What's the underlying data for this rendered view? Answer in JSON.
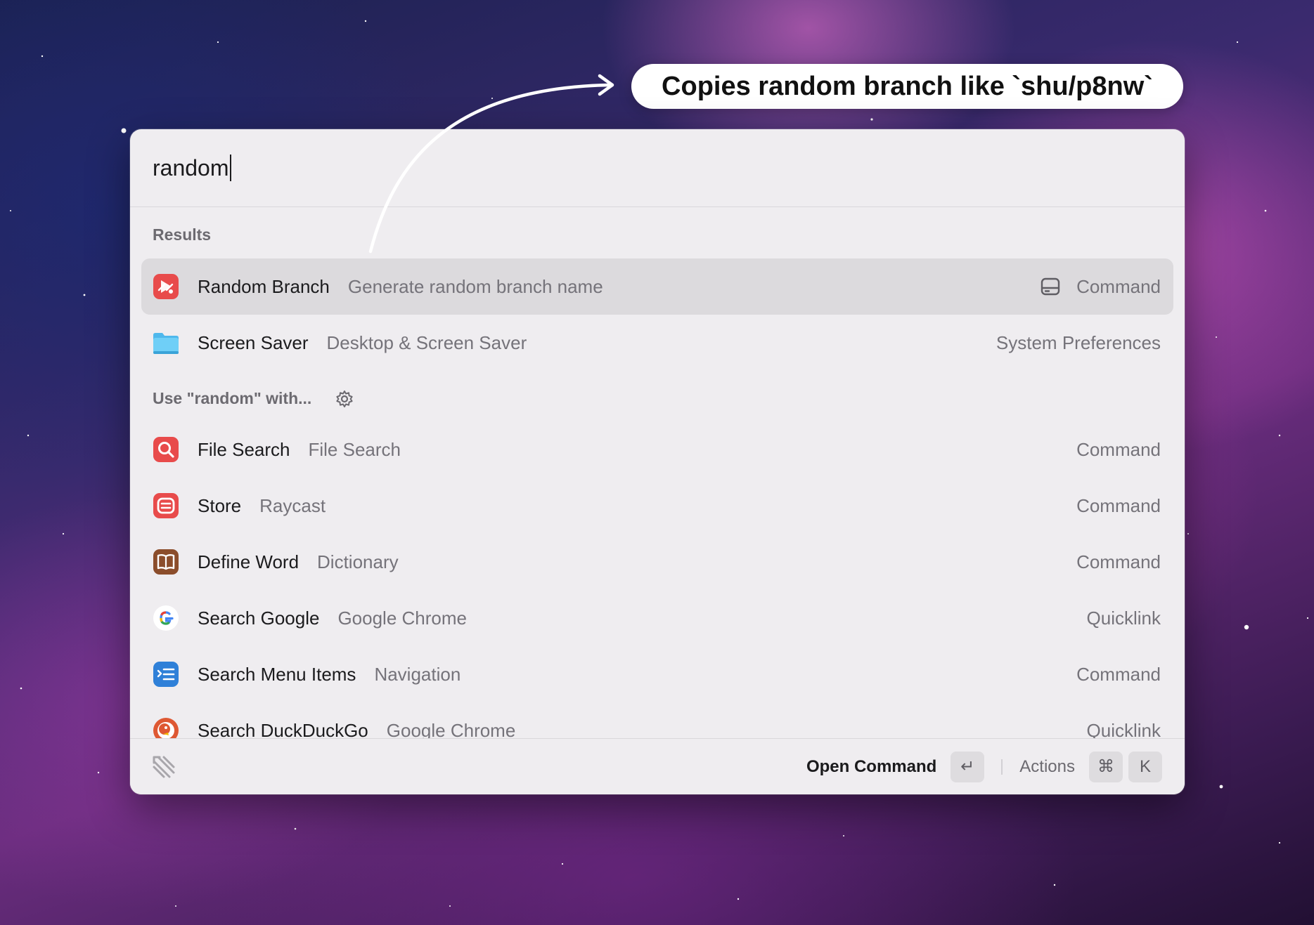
{
  "annotation": {
    "text": "Copies random branch like `shu/p8nw`"
  },
  "search": {
    "query": "random"
  },
  "sections": {
    "results": "Results",
    "fallback": "Use \"random\" with..."
  },
  "results": [
    {
      "title": "Random Branch",
      "subtitle": "Generate random branch name",
      "accessory": "Command",
      "icon": "random-branch-icon",
      "selected": true
    },
    {
      "title": "Screen Saver",
      "subtitle": "Desktop & Screen Saver",
      "accessory": "System Preferences",
      "icon": "folder-icon"
    }
  ],
  "fallbacks": [
    {
      "title": "File Search",
      "subtitle": "File Search",
      "accessory": "Command",
      "icon": "magnifier-icon"
    },
    {
      "title": "Store",
      "subtitle": "Raycast",
      "accessory": "Command",
      "icon": "store-icon"
    },
    {
      "title": "Define Word",
      "subtitle": "Dictionary",
      "accessory": "Command",
      "icon": "dictionary-icon"
    },
    {
      "title": "Search Google",
      "subtitle": "Google Chrome",
      "accessory": "Quicklink",
      "icon": "google-icon"
    },
    {
      "title": "Search Menu Items",
      "subtitle": "Navigation",
      "accessory": "Command",
      "icon": "menu-items-icon"
    },
    {
      "title": "Search DuckDuckGo",
      "subtitle": "Google Chrome",
      "accessory": "Quicklink",
      "icon": "duckduckgo-icon"
    }
  ],
  "footer": {
    "primary_action": "Open Command",
    "enter_key": "↵",
    "actions_label": "Actions",
    "cmd_key": "⌘",
    "k_key": "K"
  },
  "colors": {
    "accent_red": "#e84b4b",
    "panel_bg": "#efedf0",
    "selected_bg": "#dcdadd"
  }
}
